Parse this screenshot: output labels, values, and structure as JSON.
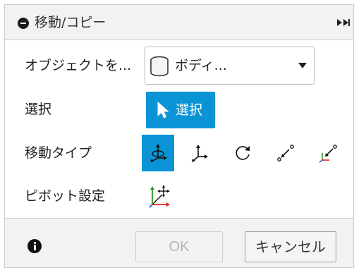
{
  "titlebar": {
    "title": "移動/コピー"
  },
  "rows": {
    "object": {
      "label": "オブジェクトを..."
    },
    "select": {
      "label": "選択"
    },
    "move_type": {
      "label": "移動タイプ"
    },
    "pivot": {
      "label": "ピボット設定"
    }
  },
  "object_dropdown": {
    "value": "ボディ..."
  },
  "select_button": {
    "label": "選択"
  },
  "move_type_options": [
    {
      "icon": "free-move-icon",
      "active": true
    },
    {
      "icon": "translate-icon",
      "active": false
    },
    {
      "icon": "rotate-icon",
      "active": false
    },
    {
      "icon": "point-to-point-icon",
      "active": false
    },
    {
      "icon": "point-to-position-icon",
      "active": false
    }
  ],
  "footer": {
    "ok_label": "OK",
    "cancel_label": "キャンセル",
    "ok_enabled": false
  },
  "colors": {
    "accent": "#0a94d6",
    "panel_bg": "#f2f2f2",
    "disabled_text": "#b5b5b5"
  }
}
